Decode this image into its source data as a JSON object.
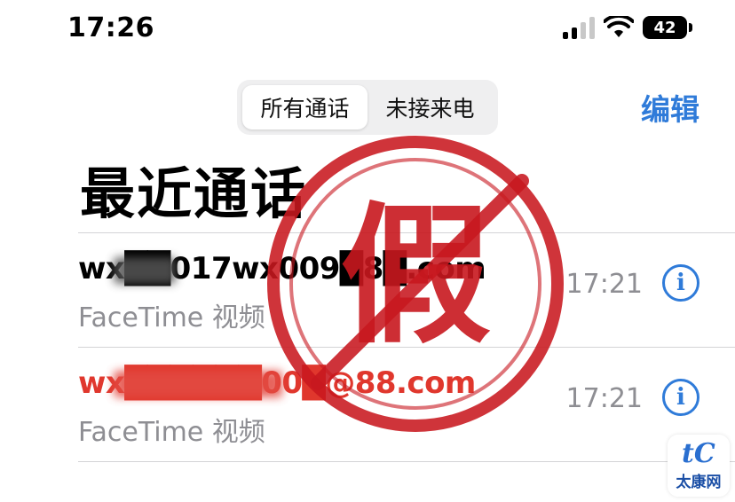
{
  "status_bar": {
    "time": "17:26",
    "battery_level": "42",
    "icons": [
      "cellular-signal-icon",
      "wifi-icon",
      "battery-icon"
    ]
  },
  "segmented_control": {
    "options": [
      "所有通话",
      "未接来电"
    ],
    "selected": "所有通话"
  },
  "header": {
    "edit_label": "编辑",
    "title": "最近通话"
  },
  "calls": [
    {
      "contact": "wx██017wx009█8█.com",
      "type": "FaceTime 视频",
      "time": "17:21",
      "missed": false
    },
    {
      "contact": "wx██████00█@88.com",
      "type": "FaceTime 视频",
      "time": "17:21",
      "missed": true
    }
  ],
  "overlay": {
    "stamp_char": "假",
    "watermark_text": "太康网"
  },
  "colors": {
    "accent": "#2f7bd9",
    "missed": "#e0372d",
    "stamp": "#c8181f",
    "secondary_text": "#8e8e93"
  }
}
